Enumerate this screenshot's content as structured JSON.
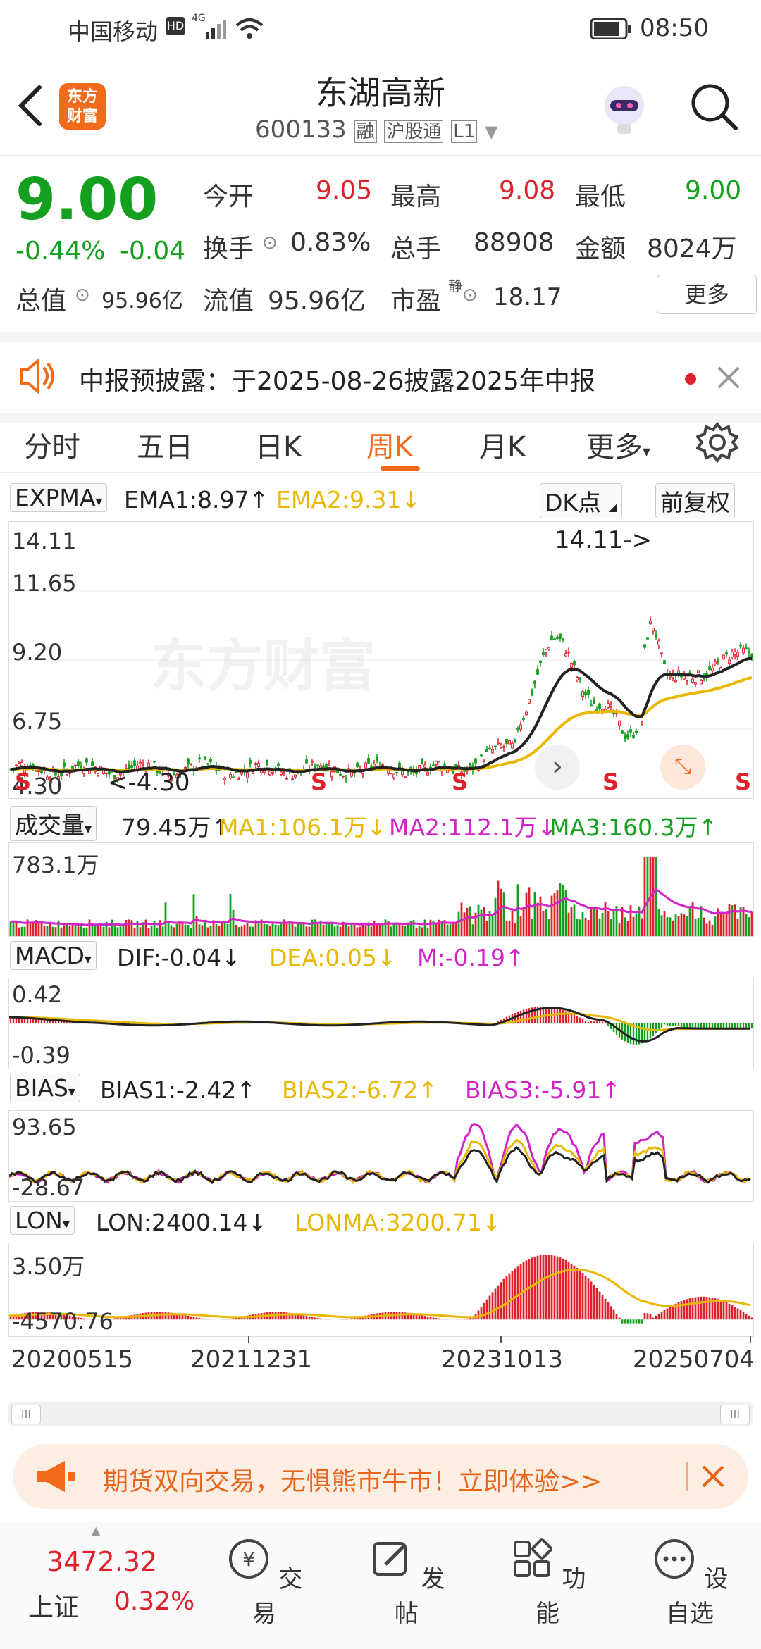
{
  "status_bar": {
    "carrier": "中国移动",
    "time": "08:50",
    "network": "4G"
  },
  "header": {
    "app_logo": "东方\n财富",
    "title": "东湖高新",
    "code": "600133",
    "tags": [
      "融",
      "沪股通",
      "L1"
    ]
  },
  "quote": {
    "price": "9.00",
    "change_pct": "-0.44%",
    "change": "-0.04",
    "open_label": "今开",
    "open": "9.05",
    "high_label": "最高",
    "high": "9.08",
    "low_label": "最低",
    "low": "9.00",
    "turnover_label": "换手",
    "turnover": "0.83%",
    "volume_label": "总手",
    "volume": "88908",
    "amount_label": "金额",
    "amount": "8024万",
    "mktcap_label": "总值",
    "mktcap": "95.96亿",
    "float_label": "流值",
    "float": "95.96亿",
    "pe_label": "市盈",
    "pe_sup": "静",
    "pe": "18.17",
    "more_button": "更多"
  },
  "notice": {
    "text": "中报预披露：于2025-08-26披露2025年中报"
  },
  "tabs": [
    "分时",
    "五日",
    "日K",
    "周K",
    "月K",
    "更多"
  ],
  "active_tab": "周K",
  "chart_toolbar": {
    "indicator": "EXPMA",
    "ema1": "EMA1:8.97↑",
    "ema2": "EMA2:9.31↓",
    "dk_button": "DK点",
    "adjust_button": "前复权"
  },
  "price_axis": [
    "14.11",
    "11.65",
    "9.20",
    "6.75",
    "4.30"
  ],
  "price_marks": {
    "max_label": "14.11->",
    "min_label": "<-4.30",
    "sell_marks": [
      "S",
      "S",
      "S",
      "S",
      "S",
      "S"
    ]
  },
  "watermark": "东方财富",
  "volume": {
    "indicator": "成交量",
    "val": "79.45万↑",
    "ma1": "MA1:106.1万↓",
    "ma2": "MA2:112.1万↓",
    "ma3": "MA3:160.3万↑",
    "axis_max": "783.1万"
  },
  "macd": {
    "indicator": "MACD",
    "dif": "DIF:-0.04↓",
    "dea": "DEA:0.05↓",
    "m": "M:-0.19↑",
    "axis": [
      "0.42",
      "-0.39"
    ]
  },
  "bias": {
    "indicator": "BIAS",
    "b1": "BIAS1:-2.42↑",
    "b2": "BIAS2:-6.72↑",
    "b3": "BIAS3:-5.91↑",
    "axis": [
      "93.65",
      "-28.67"
    ]
  },
  "lon": {
    "indicator": "LON",
    "lon": "LON:2400.14↓",
    "lonma": "LONMA:3200.71↓",
    "axis": [
      "3.50万",
      "-4570.76"
    ]
  },
  "dates": [
    "20200515",
    "20211231",
    "20231013",
    "20250704"
  ],
  "ad_banner": {
    "text": "期货双向交易，无惧熊市牛市！立即体验>>"
  },
  "tabbar": {
    "index_value": "3472.32",
    "index_name": "上证",
    "index_change": "0.32%",
    "items": [
      "交易",
      "发帖",
      "功能",
      "设自选"
    ]
  },
  "colors": {
    "up": "#e0202a",
    "down": "#14a01e",
    "accent": "#f26a1b",
    "ema2": "#e8b800",
    "ma2": "#d223c8"
  }
}
